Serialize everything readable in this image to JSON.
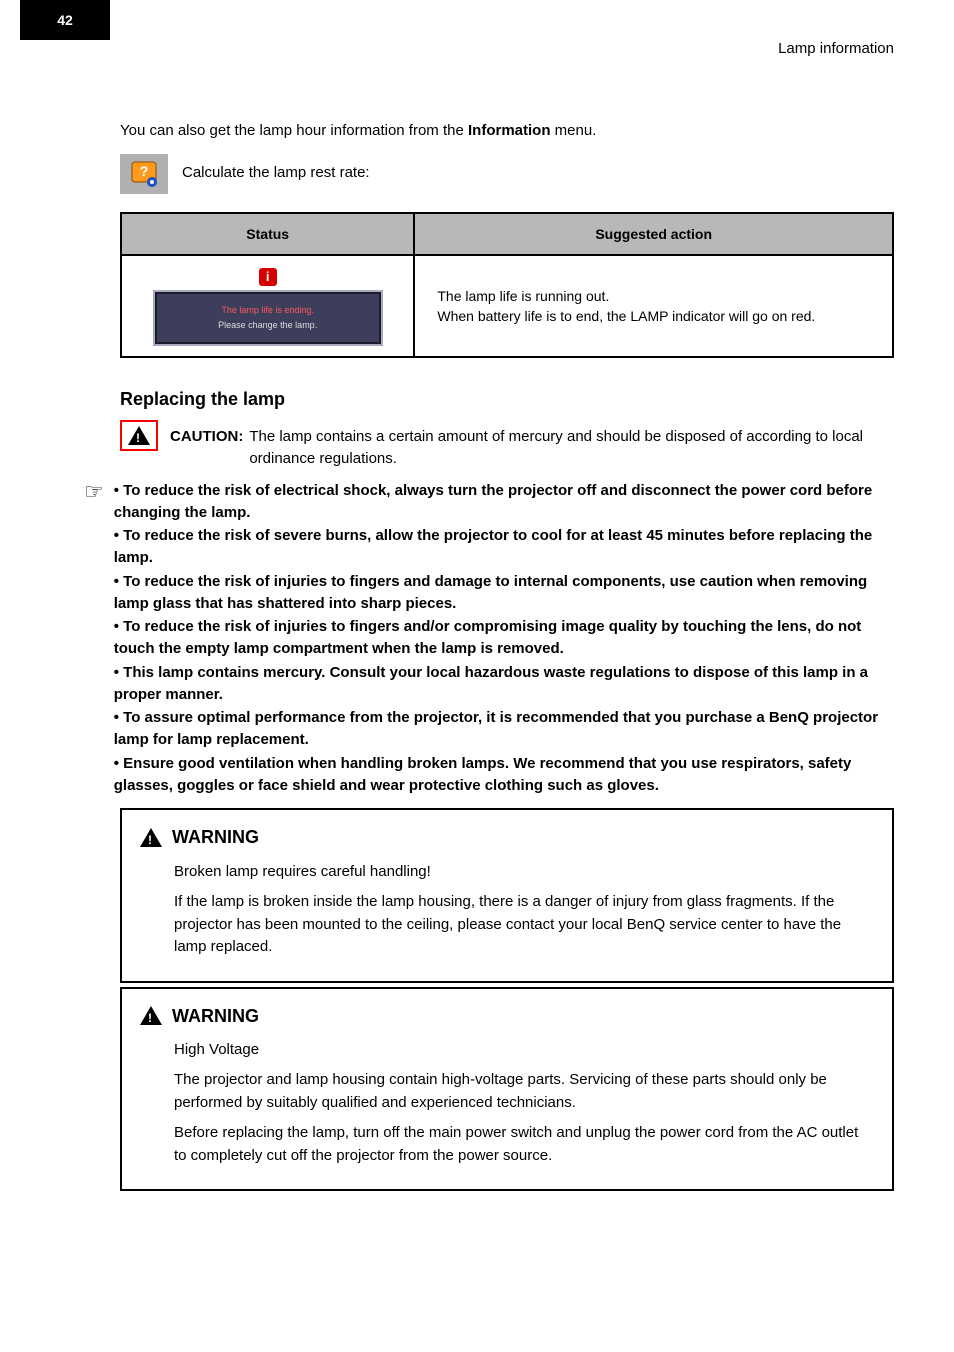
{
  "page_number": "42",
  "header_title": "Lamp information",
  "intro_line_1": "You can also get the lamp hour information from the",
  "intro_bold": " Information",
  "intro_line_2": " menu.",
  "info_icon_line": "Calculate the lamp rest rate:",
  "table": {
    "th_status": "Status",
    "th_action": "Suggested action",
    "osd_line1": "The lamp life is ending.",
    "osd_line2": "Please change the lamp.",
    "action_text": "The lamp life is running out.\nWhen battery life is to end, the LAMP indicator will go on red."
  },
  "section_replace_heading": "Replacing the lamp",
  "caution": {
    "label": "CAUTION:",
    "text": "The lamp contains a certain amount of mercury and should be disposed of according to local ordinance regulations."
  },
  "bullets": {
    "b1_title": "To reduce the risk of electrical shock, always turn the projector off and disconnect the power cord before changing the lamp.",
    "b2_title": "To reduce the risk of severe burns, allow the projector to cool for at least 45 minutes before replacing the lamp.",
    "b3_title": "To reduce the risk of injuries to fingers and damage to internal components, use caution when removing lamp glass that has shattered into sharp pieces.",
    "b4_title": "To reduce the risk of injuries to fingers and/or compromising image quality by touching the lens, do not touch the empty lamp compartment when the lamp is removed.",
    "b5_title": "This lamp contains mercury. Consult your local hazardous waste regulations to dispose of this lamp in a proper manner.",
    "b6_title": "To assure optimal performance from the projector, it is recommended that you purchase a BenQ projector lamp for lamp replacement.",
    "b7_title": "Ensure good ventilation when handling broken lamps. We recommend that you use respirators, safety glasses, goggles or face shield and wear protective clothing such as gloves."
  },
  "warn1": {
    "label": "WARNING",
    "p1": "Broken lamp requires careful handling!",
    "p2": "If the lamp is broken inside the lamp housing, there is a danger of injury from glass fragments. If the projector has been mounted to the ceiling, please contact your local BenQ service center to have the lamp replaced."
  },
  "warn2": {
    "label": "WARNING",
    "p1": "High Voltage",
    "p2": "The projector and lamp housing contain high-voltage parts. Servicing of these parts should only be performed by suitably qualified and experienced technicians.",
    "p3": "Before replacing the lamp, turn off the main power switch and unplug the power cord from the AC outlet to completely cut off the projector from the power source."
  }
}
